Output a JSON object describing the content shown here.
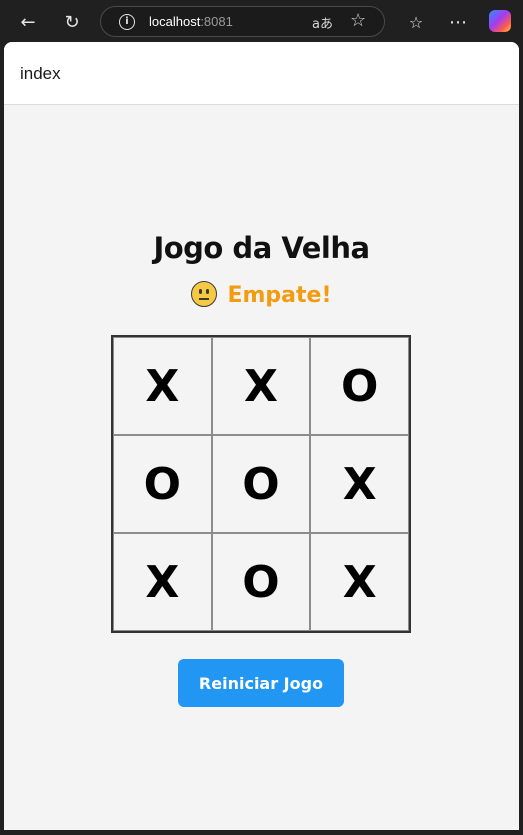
{
  "browser": {
    "url_host": "localhost",
    "url_port": ":8081"
  },
  "app": {
    "header_title": "index",
    "title": "Jogo da Velha",
    "status_text": "Empate!",
    "status_color": "#f39c12",
    "status_icon": "neutral-face-emoji",
    "restart_label": "Reiniciar Jogo",
    "restart_color": "#2196f3"
  },
  "board": [
    "X",
    "X",
    "O",
    "O",
    "O",
    "X",
    "X",
    "O",
    "X"
  ]
}
